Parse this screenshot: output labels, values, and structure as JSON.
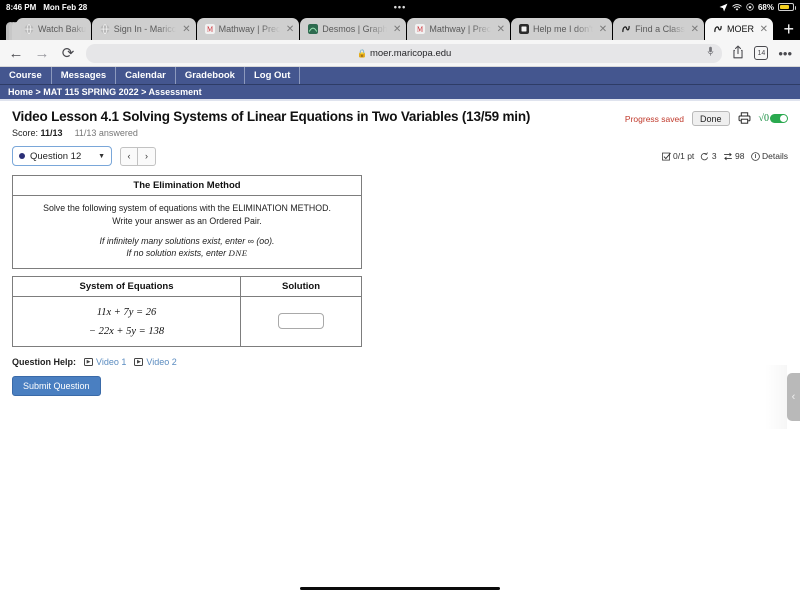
{
  "status_bar": {
    "time": "8:46 PM",
    "date": "Mon Feb 28",
    "center_dots": "•••",
    "location_icon": "location-arrow-icon",
    "wifi_icon": "wifi-icon",
    "lock_icon": "rotation-lock-icon",
    "battery_percent": "68%"
  },
  "browser": {
    "tabs": [
      {
        "title": "Watch Baku",
        "favicon": "globe-icon",
        "active": false,
        "has_close": false
      },
      {
        "title": "Sign In - Marico",
        "favicon": "globe-icon",
        "active": false,
        "has_close": true
      },
      {
        "title": "Mathway | Prec",
        "favicon": "mathway-icon",
        "active": false,
        "has_close": true
      },
      {
        "title": "Desmos | Graph",
        "favicon": "desmos-icon",
        "active": false,
        "has_close": true
      },
      {
        "title": "Mathway | Prec",
        "favicon": "mathway-icon",
        "active": false,
        "has_close": true
      },
      {
        "title": "Help me I don't",
        "favicon": "document-icon",
        "active": false,
        "has_close": true
      },
      {
        "title": "Find a Class",
        "favicon": "moer-icon",
        "active": false,
        "has_close": true
      },
      {
        "title": "MOER",
        "favicon": "moer-icon",
        "active": true,
        "has_close": true
      }
    ],
    "new_tab_label": "+",
    "back_label": "←",
    "forward_label": "→",
    "reload_label": "⟳",
    "url": "moer.maricopa.edu",
    "url_lock": "🔒",
    "mic_label": "🎤",
    "share_label": "share-icon",
    "tab_count": "14",
    "more_label": "•••"
  },
  "site_nav": {
    "items": [
      {
        "label": "Course"
      },
      {
        "label": "Messages"
      },
      {
        "label": "Calendar"
      },
      {
        "label": "Gradebook"
      },
      {
        "label": "Log Out"
      }
    ]
  },
  "breadcrumb": {
    "text": "Home > MAT 115 SPRING 2022 > Assessment"
  },
  "assessment": {
    "title": "Video Lesson 4.1 Solving Systems of Linear Equations in Two Variables (13/59 min)",
    "progress_saved": "Progress saved",
    "done_label": "Done",
    "print_icon": "printer-icon",
    "math_toggle_label": "√0",
    "math_toggle_state": "on",
    "score_label": "Score:",
    "score_value": "11/13",
    "answered": "11/13 answered"
  },
  "question_toolbar": {
    "selected_question": "Question 12",
    "prev_label": "‹",
    "next_label": "›",
    "points": "0/1 pt",
    "attempts_icon": "undo-icon",
    "attempts": "3",
    "versions_icon": "shuffle-icon",
    "versions": "98",
    "details_icon": "info-icon",
    "details_label": "Details"
  },
  "question": {
    "card_title": "The Elimination Method",
    "instruction_line1": "Solve the following system of equations with the ELIMINATION METHOD.",
    "instruction_line2": "Write your answer as an Ordered Pair.",
    "note_line1": "If infinitely many solutions exist, enter ∞ (oo).",
    "note_line2_prefix": "If no solution exists, enter ",
    "note_line2_math": "DNE",
    "table": {
      "headers": [
        "System of Equations",
        "Solution"
      ],
      "equations": [
        "11x + 7y = 26",
        "− 22x + 5y = 138"
      ],
      "answer_value": "",
      "answer_placeholder": ""
    }
  },
  "help": {
    "label": "Question Help:",
    "links": [
      {
        "label": "Video 1",
        "icon": "play-icon"
      },
      {
        "label": "Video 2",
        "icon": "play-icon"
      }
    ]
  },
  "actions": {
    "submit_label": "Submit Question"
  },
  "sidebar_handle": {
    "icon": "chevron-left-icon"
  },
  "colors": {
    "nav_blue": "#44568f",
    "submit_blue": "#4a7fc1",
    "progress_red": "#c0392b",
    "toggle_green": "#2aa94f",
    "link_blue": "#5b8cc0"
  }
}
